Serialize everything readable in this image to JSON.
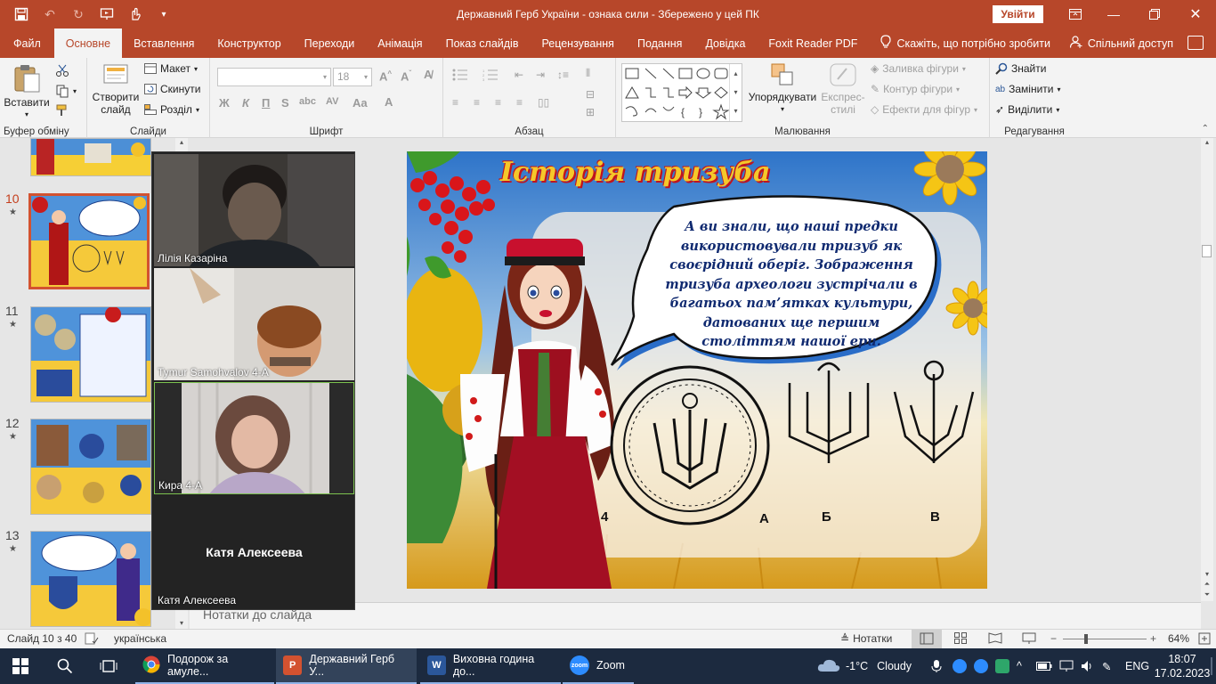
{
  "window": {
    "title": "Державний Герб України - ознака сили  -  Збережено у цей ПК",
    "signin": "Увійти"
  },
  "tabs": [
    "Файл",
    "Основне",
    "Вставлення",
    "Конструктор",
    "Переходи",
    "Анімація",
    "Показ слайдів",
    "Рецензування",
    "Подання",
    "Довідка",
    "Foxit Reader PDF"
  ],
  "tell_me": "Скажіть, що потрібно зробити",
  "share": "Спільний доступ",
  "ribbon": {
    "clipboard": {
      "paste": "Вставити",
      "label": "Буфер обміну"
    },
    "slides": {
      "new_slide": "Створити слайд",
      "layout": "Макет",
      "reset": "Скинути",
      "section": "Розділ",
      "label": "Слайди"
    },
    "font": {
      "font_size": "18",
      "bold": "Ж",
      "italic": "К",
      "underline": "П",
      "strike": "S",
      "label": "Шрифт"
    },
    "paragraph": {
      "label": "Абзац"
    },
    "drawing": {
      "arrange": "Упорядкувати",
      "quick_styles": "Експрес-стилі",
      "fill": "Заливка фігури",
      "outline": "Контур фігури",
      "effects": "Ефекти для фігур",
      "label": "Малювання"
    },
    "editing": {
      "find": "Знайти",
      "replace": "Замінити",
      "select": "Виділити",
      "label": "Редагування"
    }
  },
  "thumbnails": [
    {
      "num": "10",
      "selected": true
    },
    {
      "num": "11",
      "selected": false
    },
    {
      "num": "12",
      "selected": false
    },
    {
      "num": "13",
      "selected": false
    }
  ],
  "zoom_participants": [
    {
      "name": "Лілія Казаріна"
    },
    {
      "name": "Tymur Samohvalov 4-А"
    },
    {
      "name": "Кира 4-А"
    },
    {
      "name": "Катя Алексеева",
      "big_name": "Катя Алексеева"
    }
  ],
  "slide": {
    "title": "Історія тризуба",
    "bubble": "А ви знали, що наші предки використовували тризуб як своєрідний оберіг. Зображення тризуба археологи зустрічали в багатьох пам’ятках культури, датованих ще першим століттям нашої ери.",
    "label_4": "4",
    "label_a": "А",
    "label_b": "Б",
    "label_v": "В"
  },
  "notes_placeholder": "Нотатки до слайда",
  "status": {
    "slide_of": "Слайд 10 з 40",
    "language": "українська",
    "notes": "Нотатки",
    "zoom": "64%"
  },
  "taskbar": {
    "chrome": "Подорож за амуле...",
    "powerpoint": "Державний Герб У...",
    "word": "Виховна година до...",
    "zoom": "Zoom",
    "weather_temp": "-1°C",
    "weather_desc": "Cloudy",
    "lang": "ENG",
    "time": "18:07",
    "date": "17.02.2023"
  }
}
